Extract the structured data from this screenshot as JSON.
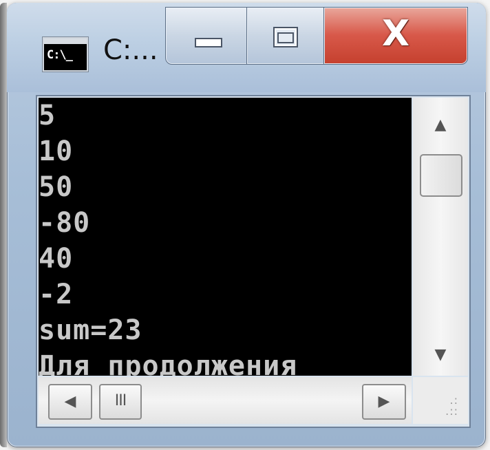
{
  "window": {
    "title": "C:...",
    "icon_label": "C:\\_",
    "icon_name": "console-app-icon"
  },
  "caption_buttons": {
    "minimize_icon": "minimize-icon",
    "maximize_icon": "maximize-icon",
    "close_glyph": "X"
  },
  "console": {
    "lines": [
      "5",
      "10",
      "50",
      "-80",
      "40",
      "-2",
      "sum=23",
      "Для продолжения"
    ],
    "background": "#000000",
    "text_color": "#c8c8c8"
  },
  "scrollbars": {
    "up_arrow": "▲",
    "down_arrow": "▼",
    "left_arrow": "◀",
    "right_arrow": "▶",
    "h_thumb_grip": "III"
  },
  "colors": {
    "close_button": "#d8594a",
    "frame": "#a7bed7"
  }
}
